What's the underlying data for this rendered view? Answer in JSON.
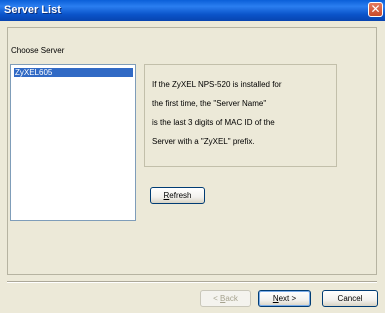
{
  "window": {
    "title": "Server List",
    "close_glyph": "✕"
  },
  "choose_server_label": "Choose Server",
  "server_list": {
    "items": [
      "ZyXEL605"
    ],
    "selected_index": 0
  },
  "info": {
    "lines": [
      "If the ZyXEL NPS-520 is installed for",
      "the first time, the \"Server Name\"",
      "is the last 3 digits of MAC ID of the",
      "Server with a \"ZyXEL\" prefix."
    ]
  },
  "buttons": {
    "refresh": {
      "mnemonic": "R",
      "rest": "efresh"
    },
    "back": {
      "prefix": "< ",
      "mnemonic": "B",
      "rest": "ack"
    },
    "next": {
      "mnemonic": "N",
      "rest": "ext >"
    },
    "cancel": "Cancel"
  },
  "colors": {
    "titlebar": "#0a5fd8",
    "selection": "#316ac5",
    "face": "#ece9d8"
  }
}
